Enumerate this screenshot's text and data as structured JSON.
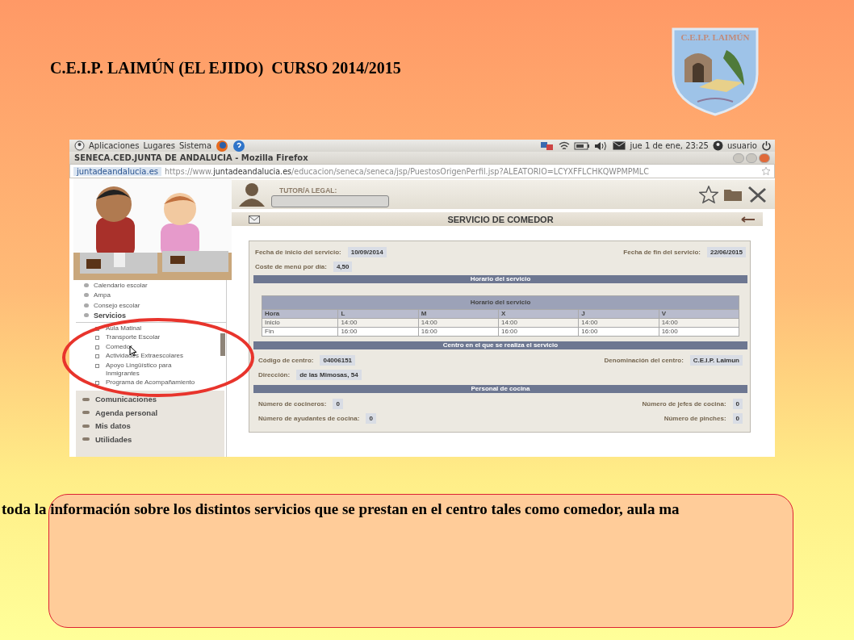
{
  "slide": {
    "title": "C.E.I.P. LAIMÚN (EL EJIDO)  CURSO 2014/2015",
    "logo_text": "C.E.I.P. LAIMÚN",
    "caption": "toda la información sobre los distintos servicios que se prestan en el centro tales como comedor, aula ma"
  },
  "desktop_panel": {
    "menus": [
      "Aplicaciones",
      "Lugares",
      "Sistema"
    ],
    "clock": "jue 1 de ene, 23:25",
    "user": "usuario"
  },
  "browser": {
    "title": "SENECA.CED.JUNTA DE ANDALUCIA - Mozilla Firefox",
    "identity": "juntadeandalucia.es",
    "url_prefix": "https://www.",
    "url_domain": "juntadeandalucia.es",
    "url_path": "/educacion/seneca/seneca/jsp/PuestosOrigenPerfil.jsp?ALEATORIO=LCYXFFLCHKQWPMPMLC"
  },
  "page": {
    "header_label": "TUTOR/A LEGAL:",
    "section_title": "SERVICIO DE COMEDOR",
    "sidebar": {
      "items": [
        {
          "label": "Calendario escolar"
        },
        {
          "label": "Ampa"
        },
        {
          "label": "Consejo escolar"
        },
        {
          "label": "Servicios",
          "children": [
            {
              "label": "Aula Matinal"
            },
            {
              "label": "Transporte Escolar"
            },
            {
              "label": "Comedor"
            },
            {
              "label": "Actividades Extraescolares"
            },
            {
              "label": "Apoyo Lingüístico para Inmigrantes"
            },
            {
              "label": "Programa de Acompañamiento"
            }
          ]
        }
      ],
      "sections": [
        "Comunicaciones",
        "Agenda personal",
        "Mis datos",
        "Utilidades"
      ]
    },
    "sections": [
      {
        "kind": "fields",
        "rows": [
          [
            {
              "label": "Fecha de inicio del servicio:",
              "value": "10/09/2014"
            },
            {
              "label": "Fecha de fin del servicio:",
              "value": "22/06/2015"
            }
          ],
          [
            {
              "label": "Coste de menú por día:",
              "value": "4,50"
            }
          ]
        ]
      },
      {
        "kind": "table",
        "title": "Horario del servicio",
        "table_title": "Horario del servicio",
        "columns": [
          "Hora",
          "L",
          "M",
          "X",
          "J",
          "V"
        ],
        "rows": [
          [
            "Inicio",
            "14:00",
            "14:00",
            "14:00",
            "14:00",
            "14:00"
          ],
          [
            "Fin",
            "16:00",
            "16:00",
            "16:00",
            "16:00",
            "16:00"
          ]
        ]
      },
      {
        "kind": "fields",
        "title": "Centro en el que se realiza el servicio",
        "rows": [
          [
            {
              "label": "Código de centro:",
              "value": "04006151"
            },
            {
              "label": "Denominación del centro:",
              "value": "C.E.I.P. Laimun"
            }
          ],
          [
            {
              "label": "Dirección:",
              "value": "de las Mimosas, 54"
            }
          ]
        ]
      },
      {
        "kind": "fields",
        "title": "Personal de cocina",
        "rows": [
          [
            {
              "label": "Número de cocineros:",
              "value": "0"
            },
            {
              "label": "Número de jefes de cocina:",
              "value": "0"
            }
          ],
          [
            {
              "label": "Número de ayudantes de cocina:",
              "value": "0"
            },
            {
              "label": "Número de pinches:",
              "value": "0"
            }
          ]
        ]
      }
    ]
  }
}
